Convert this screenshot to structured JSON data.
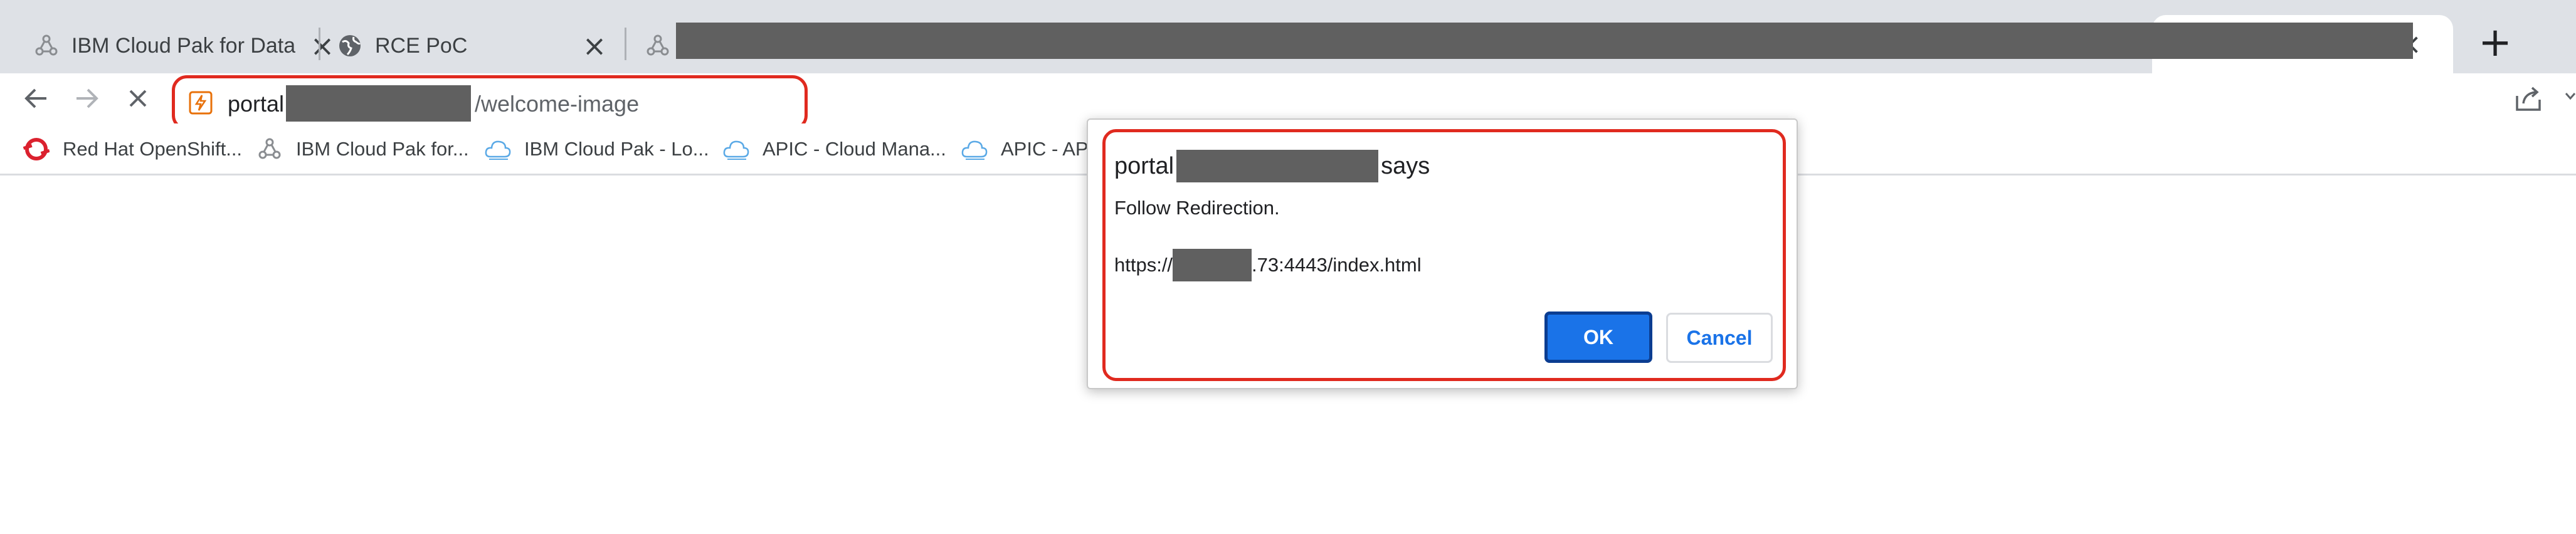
{
  "tabs": [
    {
      "title": "IBM Cloud Pak for Data",
      "icon": "cloud-pak-icon"
    },
    {
      "title": "RCE PoC",
      "icon": "globe-icon"
    },
    {
      "title": "",
      "icon": "cloud-pak-icon",
      "redacted": true
    },
    {
      "title": "",
      "active": true
    }
  ],
  "tab_close_glyph": "×",
  "new_tab_glyph": "+",
  "omnibox": {
    "host_prefix": "portal",
    "path": "/welcome-image",
    "icon": "not-secure-icon"
  },
  "bookmarks": [
    {
      "label": "Red Hat OpenShift...",
      "icon": "openshift-icon"
    },
    {
      "label": "IBM Cloud Pak for...",
      "icon": "cloud-pak-icon"
    },
    {
      "label": "IBM Cloud Pak - Lo...",
      "icon": "cloud-outline-icon"
    },
    {
      "label": "APIC - Cloud Mana...",
      "icon": "cloud-outline-icon"
    },
    {
      "label": "APIC - API",
      "icon": "cloud-outline-icon"
    }
  ],
  "dialog": {
    "title_prefix": "portal",
    "title_suffix": "says",
    "message": "Follow Redirection.",
    "url_prefix": "https://",
    "url_suffix": ".73:4443/index.html",
    "ok_label": "OK",
    "cancel_label": "Cancel"
  },
  "colors": {
    "highlight": "#e02a1f",
    "accent": "#1a73e8",
    "tabstrip": "#dee1e6",
    "redaction": "#606060"
  }
}
